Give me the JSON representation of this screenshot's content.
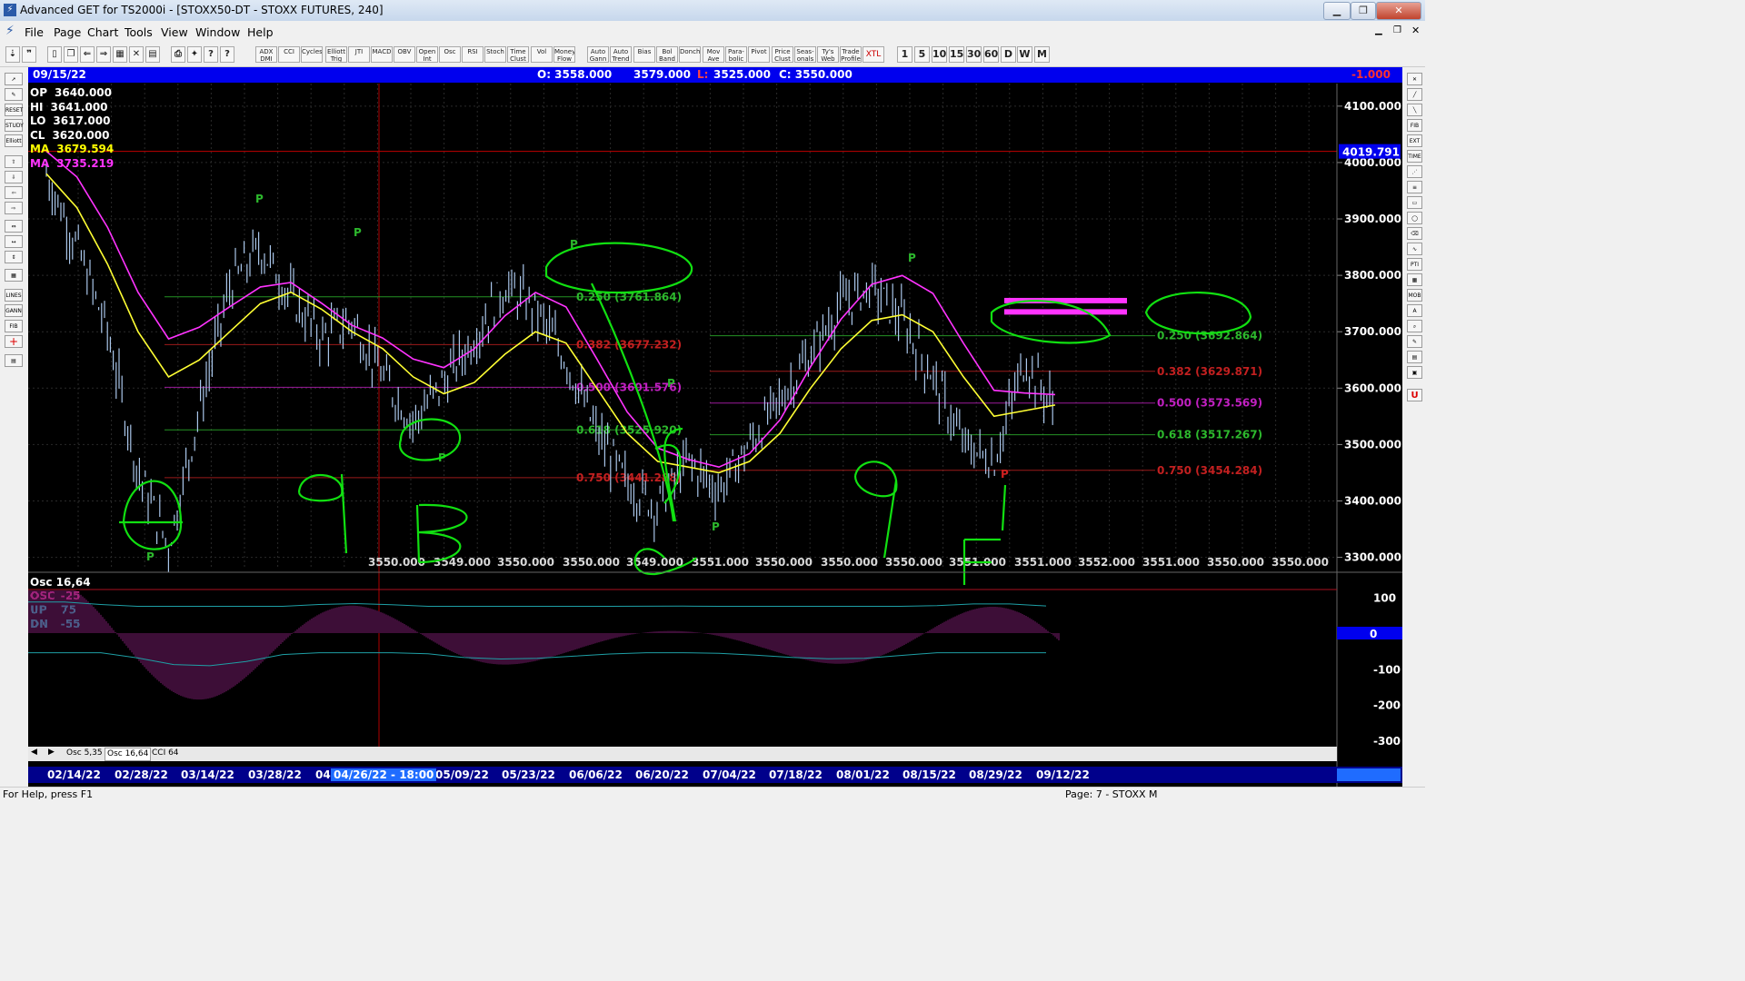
{
  "window": {
    "title": "Advanced GET for TS2000i - [STOXX50-DT - STOXX FUTURES, 240]"
  },
  "menu": [
    "File",
    "Page",
    "Chart",
    "Tools",
    "View",
    "Window",
    "Help"
  ],
  "toolbar": {
    "study_buttons": [
      "ADX DMI",
      "CCI",
      "Cycles",
      "Elliott Trig",
      "JTI",
      "MACD",
      "OBV",
      "Open Int",
      "Osc",
      "RSI",
      "Stoch",
      "Time Clust",
      "Vol",
      "Money Flow",
      "Auto Gann",
      "Auto Trend",
      "Bias",
      "Bol Band",
      "Donch",
      "Mov Ave",
      "Para-bolic",
      "Pivot",
      "Price Clust",
      "Seas-onals",
      "Ty's Web",
      "Trade Profile",
      "XTL"
    ],
    "timeframes": [
      "1",
      "5",
      "10",
      "15",
      "30",
      "60",
      "D",
      "W",
      "M"
    ]
  },
  "info_bar": {
    "date": "09/15/22",
    "open": "O: 3558.000",
    "high": "3579.000",
    "low_label": "L:",
    "low": "3525.000",
    "close": "C: 3550.000",
    "change": "-1.000"
  },
  "price_legend": [
    {
      "label": "OP",
      "value": "3640.000",
      "color": "#ffffff"
    },
    {
      "label": "HI",
      "value": "3641.000",
      "color": "#ffffff"
    },
    {
      "label": "LO",
      "value": "3617.000",
      "color": "#ffffff"
    },
    {
      "label": "CL",
      "value": "3620.000",
      "color": "#ffffff"
    },
    {
      "label": "MA",
      "value": "3679.594",
      "color": "#ffff00"
    },
    {
      "label": "MA",
      "value": "3735.219",
      "color": "#ff33ff"
    }
  ],
  "price_axis": {
    "ticks": [
      "4100.000",
      "4000.000",
      "3900.000",
      "3800.000",
      "3700.000",
      "3600.000",
      "3500.000",
      "3400.000",
      "3300.000"
    ],
    "current": "4019.791"
  },
  "fib_left": [
    {
      "text": "0.250 (3761.864)",
      "color": "#2db82d"
    },
    {
      "text": "0.382 (3677.232)",
      "color": "#c22020"
    },
    {
      "text": "0.500 (3601.576)",
      "color": "#c020c0"
    },
    {
      "text": "0.618 (3525.920)",
      "color": "#2db82d"
    },
    {
      "text": "0.750 (3441.288)",
      "color": "#c22020"
    }
  ],
  "fib_right": [
    {
      "text": "0.250 (3692.864)",
      "color": "#2db82d"
    },
    {
      "text": "0.382 (3629.871)",
      "color": "#c22020"
    },
    {
      "text": "0.500 (3573.569)",
      "color": "#c020c0"
    },
    {
      "text": "0.618 (3517.267)",
      "color": "#2db82d"
    },
    {
      "text": "0.750 (3454.284)",
      "color": "#c22020"
    }
  ],
  "cluster_labels": [
    "3550.000",
    "3549.000",
    "3550.000",
    "3550.000",
    "3549.000",
    "3551.000",
    "3550.000",
    "3550.000",
    "3550.000",
    "3551.000",
    "3551.000",
    "3552.000",
    "3551.000",
    "3550.000",
    "3550.000"
  ],
  "pivot_marks": [
    "P",
    "P",
    "P",
    "P",
    "P",
    "P",
    "P",
    "P",
    "P"
  ],
  "oscillator": {
    "title": "Osc 16,64",
    "legend": [
      {
        "label": "OSC",
        "value": "-25",
        "color": "#cc2a8a"
      },
      {
        "label": "UP",
        "value": "75",
        "color": "#1e9fa5"
      },
      {
        "label": "DN",
        "value": "-55",
        "color": "#1e9fa5"
      }
    ],
    "axis_ticks": [
      "100",
      "0",
      "-100",
      "-200",
      "-300"
    ]
  },
  "bottom_tabs": [
    "Osc 5,35",
    "Osc 16,64",
    "CCI 64"
  ],
  "dates": [
    "02/14/22",
    "02/28/22",
    "03/14/22",
    "03/28/22",
    "04",
    "05/09/22",
    "05/23/22",
    "06/06/22",
    "06/20/22",
    "07/04/22",
    "07/18/22",
    "08/01/22",
    "08/15/22",
    "08/29/22",
    "09/12/22"
  ],
  "cursor_date": "04/26/22 - 18:00",
  "status": {
    "left": "For Help, press F1",
    "right": "Page: 7 - STOXX M"
  },
  "annotations": [
    "A",
    "B",
    "C",
    "9",
    "9",
    "F",
    "9"
  ],
  "chart_data": {
    "type": "line",
    "series": [
      {
        "values": [
          3980,
          3850,
          3700,
          3450,
          3320,
          3560,
          3780,
          3850,
          3760,
          3690,
          3720,
          3620,
          3540,
          3610,
          3690,
          3780,
          3740,
          3650,
          3520,
          3430,
          3390,
          3470,
          3420,
          3500,
          3580,
          3660,
          3750,
          3780,
          3720,
          3620,
          3500,
          3470,
          3650,
          3560
        ]
      },
      {
        "values": [
          3980,
          3920,
          3820,
          3700,
          3620,
          3650,
          3700,
          3750,
          3770,
          3740,
          3700,
          3670,
          3620,
          3590,
          3610,
          3660,
          3700,
          3680,
          3600,
          3520,
          3470,
          3460,
          3450,
          3470,
          3520,
          3600,
          3670,
          3720,
          3730,
          3700,
          3620,
          3550,
          3560,
          3570
        ]
      }
    ],
    "ylim": [
      3280,
      4140
    ]
  }
}
